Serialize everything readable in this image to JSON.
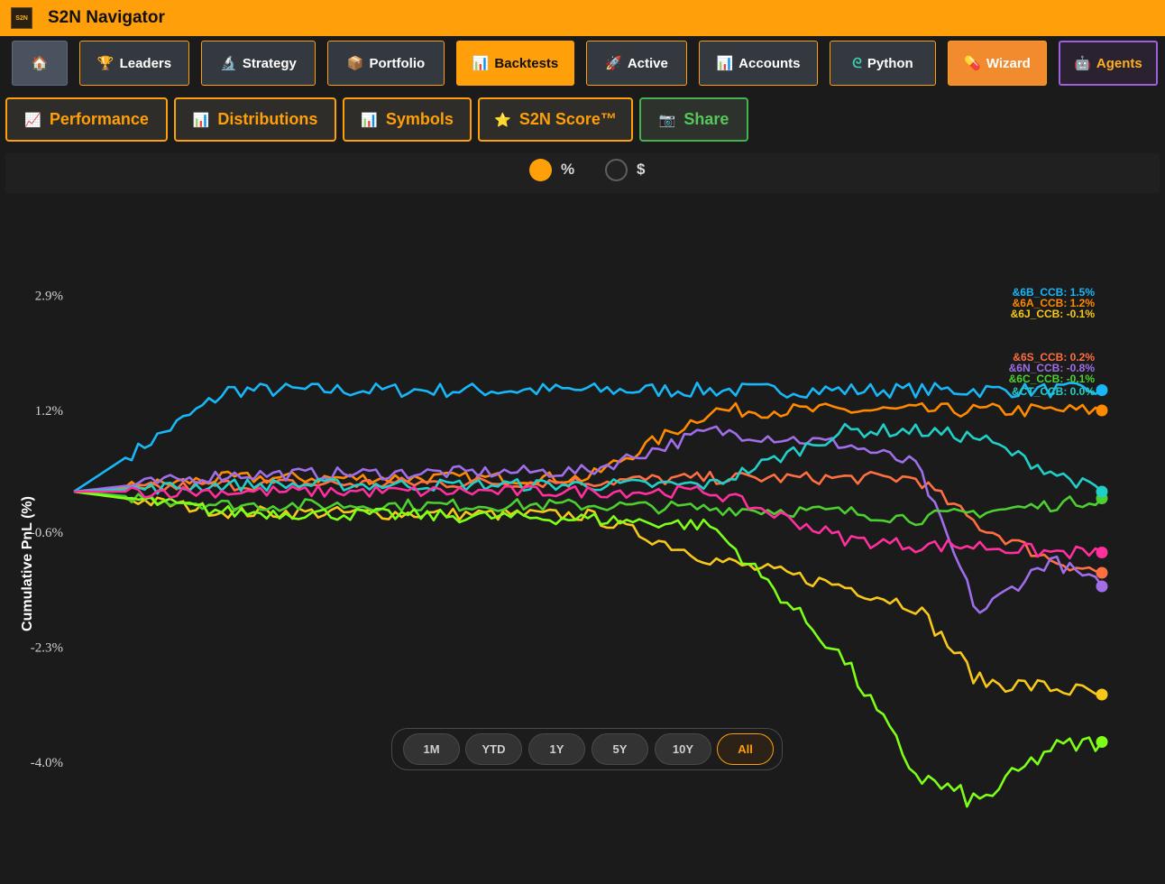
{
  "app": {
    "title": "S2N Navigator",
    "logo_text": "S2N"
  },
  "nav": [
    {
      "label": "",
      "icon": "home-icon"
    },
    {
      "label": "Leaders",
      "icon": "trophy-icon"
    },
    {
      "label": "Strategy",
      "icon": "microscope-icon"
    },
    {
      "label": "Portfolio",
      "icon": "package-icon"
    },
    {
      "label": "Backtests",
      "icon": "bar-chart-icon",
      "active": true
    },
    {
      "label": "Active",
      "icon": "rocket-icon"
    },
    {
      "label": "Accounts",
      "icon": "bar-chart-icon"
    },
    {
      "label": "Python",
      "icon": "python-icon"
    },
    {
      "label": "Wizard",
      "icon": "pill-icon"
    },
    {
      "label": "Agents",
      "icon": "robot-icon"
    }
  ],
  "subtabs": [
    {
      "label": "Performance",
      "icon": "trend-icon"
    },
    {
      "label": "Distributions",
      "icon": "bar-chart-icon"
    },
    {
      "label": "Symbols",
      "icon": "bar-chart-icon"
    },
    {
      "label": "S2N Score™",
      "icon": "star-icon"
    },
    {
      "label": "Share",
      "icon": "camera-icon"
    }
  ],
  "units": {
    "percent_label": "%",
    "dollar_label": "$",
    "selected": "%"
  },
  "ranges": {
    "options": [
      "1M",
      "YTD",
      "1Y",
      "5Y",
      "10Y",
      "All"
    ],
    "selected": "All"
  },
  "colors": {
    "accent": "#ff9f0a",
    "background": "#1b1b1b",
    "share_green": "#45b34d",
    "agents_purple": "#9f5fe0"
  },
  "chart_data": {
    "type": "line",
    "ylabel": "Cumulative PnL (%)",
    "yticks": [
      "2.9%",
      "1.2%",
      "-0.6%",
      "-2.3%",
      "-4.0%"
    ],
    "ylim": [
      -5.0,
      3.8
    ],
    "x": [
      0,
      0.15,
      0.5,
      0.62,
      0.75,
      0.82,
      0.88,
      0.95,
      1.0
    ],
    "series": [
      {
        "name": "&6B_CCB: 1.5%",
        "color": "#18b7f7",
        "values": [
          0.0,
          1.5,
          1.5,
          1.5,
          1.5,
          1.5,
          1.5,
          1.5,
          1.5
        ]
      },
      {
        "name": "&6A_CCB: 1.2%",
        "color": "#ff8a00",
        "values": [
          0.0,
          0.2,
          0.2,
          1.2,
          1.2,
          1.2,
          1.2,
          1.2,
          1.2
        ]
      },
      {
        "name": "&6J_CCB: -0.1%",
        "color": "#f7c81a",
        "values": [
          0.0,
          -0.3,
          -0.35,
          -1.0,
          -1.4,
          -1.7,
          -2.8,
          -2.9,
          -3.0
        ]
      },
      {
        "name": "&6S_CCB: 0.2%",
        "color": "#ff6f42",
        "values": [
          0.0,
          0.1,
          0.15,
          0.2,
          0.2,
          0.2,
          -0.5,
          -1.0,
          -1.2
        ]
      },
      {
        "name": "&6N_CCB: -0.8%",
        "color": "#9f6ee8",
        "values": [
          0.0,
          0.25,
          0.3,
          0.9,
          0.7,
          0.4,
          -1.8,
          -1.0,
          -1.4
        ]
      },
      {
        "name": "&6C_CCB: -0.1%",
        "color": "#4ecf30",
        "values": [
          0.0,
          -0.2,
          -0.2,
          -0.25,
          -0.3,
          -0.4,
          -0.3,
          -0.2,
          -0.1
        ]
      },
      {
        "name": "&CT_CCB: 0.0%",
        "color": "#20d0c8",
        "values": [
          0.0,
          0.1,
          0.1,
          0.1,
          0.9,
          0.9,
          0.8,
          0.3,
          0.0
        ]
      },
      {
        "name": "",
        "color": "#7dff18",
        "values": [
          0.0,
          -0.3,
          -0.4,
          -0.5,
          -2.5,
          -4.2,
          -4.6,
          -3.8,
          -3.7
        ]
      },
      {
        "name": "",
        "color": "#ff2f9d",
        "values": [
          0.0,
          0.0,
          0.0,
          0.0,
          -0.7,
          -0.8,
          -0.8,
          -0.9,
          -0.9
        ]
      }
    ]
  }
}
